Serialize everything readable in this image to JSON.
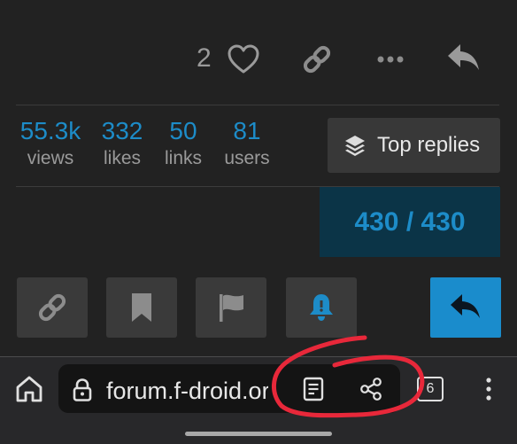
{
  "post_actions": {
    "like_count": "2",
    "icons": [
      "heart-icon",
      "link-icon",
      "ellipsis-icon",
      "reply-icon"
    ]
  },
  "stats": [
    {
      "value": "55.3k",
      "label": "views"
    },
    {
      "value": "332",
      "label": "likes"
    },
    {
      "value": "50",
      "label": "links"
    },
    {
      "value": "81",
      "label": "users"
    }
  ],
  "top_replies": {
    "label": "Top replies",
    "icon": "layers-icon"
  },
  "progress": {
    "text": "430 / 430"
  },
  "footer_buttons": {
    "icons": [
      "link-icon",
      "bookmark-icon",
      "flag-icon",
      "bell-icon",
      "reply-icon"
    ]
  },
  "browser": {
    "url": "forum.f-droid.org",
    "tab_count": "6",
    "icons": [
      "home-icon",
      "lock-icon",
      "reader-mode-icon",
      "share-icon",
      "tabs-icon",
      "menu-icon"
    ]
  },
  "colors": {
    "background": "#222222",
    "accent": "#1d8cc8",
    "progress_bg": "#0b3447",
    "reply_button": "#1a8ccc",
    "annotation": "#e8283a"
  }
}
